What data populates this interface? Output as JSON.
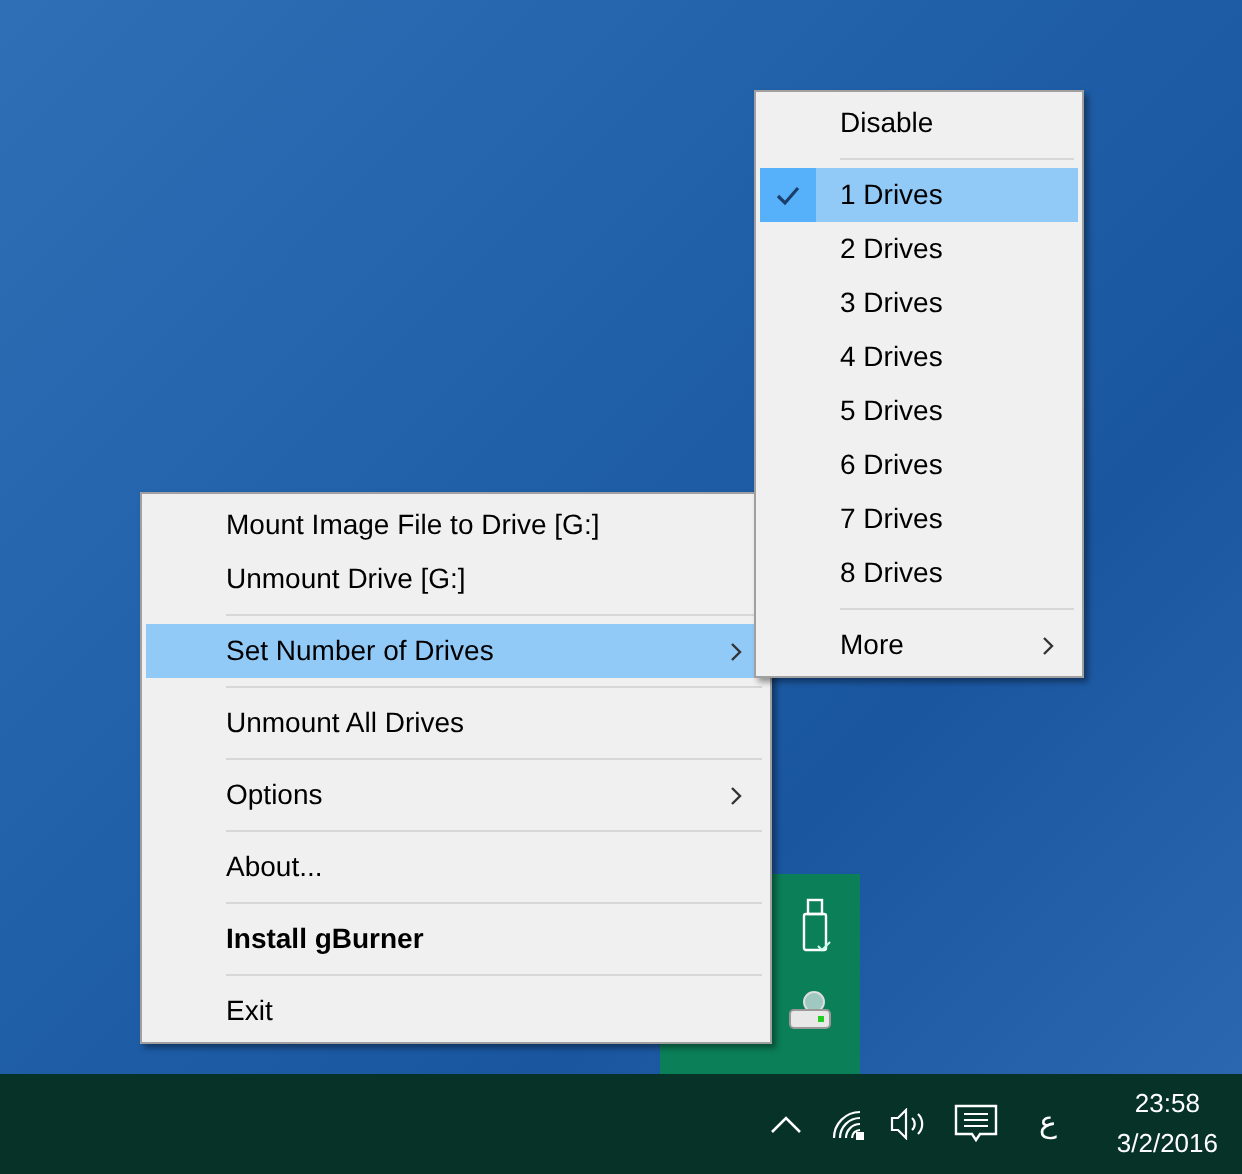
{
  "context_menu": {
    "items": [
      {
        "kind": "item",
        "label": "Mount Image File to Drive [G:]",
        "selected": false,
        "submenu": false,
        "default": false
      },
      {
        "kind": "item",
        "label": "Unmount Drive [G:]",
        "selected": false,
        "submenu": false,
        "default": false
      },
      {
        "kind": "separator"
      },
      {
        "kind": "item",
        "label": "Set Number of Drives",
        "selected": true,
        "submenu": true,
        "default": false
      },
      {
        "kind": "separator"
      },
      {
        "kind": "item",
        "label": "Unmount All Drives",
        "selected": false,
        "submenu": false,
        "default": false
      },
      {
        "kind": "separator"
      },
      {
        "kind": "item",
        "label": "Options",
        "selected": false,
        "submenu": true,
        "default": false
      },
      {
        "kind": "separator"
      },
      {
        "kind": "item",
        "label": "About...",
        "selected": false,
        "submenu": false,
        "default": false
      },
      {
        "kind": "separator"
      },
      {
        "kind": "item",
        "label": "Install gBurner",
        "selected": false,
        "submenu": false,
        "default": true
      },
      {
        "kind": "separator"
      },
      {
        "kind": "item",
        "label": "Exit",
        "selected": false,
        "submenu": false,
        "default": false
      }
    ]
  },
  "submenu": {
    "items": [
      {
        "kind": "item",
        "label": "Disable",
        "selected": false,
        "checked": false,
        "submenu": false
      },
      {
        "kind": "separator"
      },
      {
        "kind": "item",
        "label": "1 Drives",
        "selected": true,
        "checked": true,
        "submenu": false
      },
      {
        "kind": "item",
        "label": "2 Drives",
        "selected": false,
        "checked": false,
        "submenu": false
      },
      {
        "kind": "item",
        "label": "3 Drives",
        "selected": false,
        "checked": false,
        "submenu": false
      },
      {
        "kind": "item",
        "label": "4 Drives",
        "selected": false,
        "checked": false,
        "submenu": false
      },
      {
        "kind": "item",
        "label": "5 Drives",
        "selected": false,
        "checked": false,
        "submenu": false
      },
      {
        "kind": "item",
        "label": "6 Drives",
        "selected": false,
        "checked": false,
        "submenu": false
      },
      {
        "kind": "item",
        "label": "7 Drives",
        "selected": false,
        "checked": false,
        "submenu": false
      },
      {
        "kind": "item",
        "label": "8 Drives",
        "selected": false,
        "checked": false,
        "submenu": false
      },
      {
        "kind": "separator"
      },
      {
        "kind": "item",
        "label": "More",
        "selected": false,
        "checked": false,
        "submenu": true
      }
    ]
  },
  "taskbar": {
    "input_language": "ع",
    "time": "23:58",
    "date": "3/2/2016"
  }
}
